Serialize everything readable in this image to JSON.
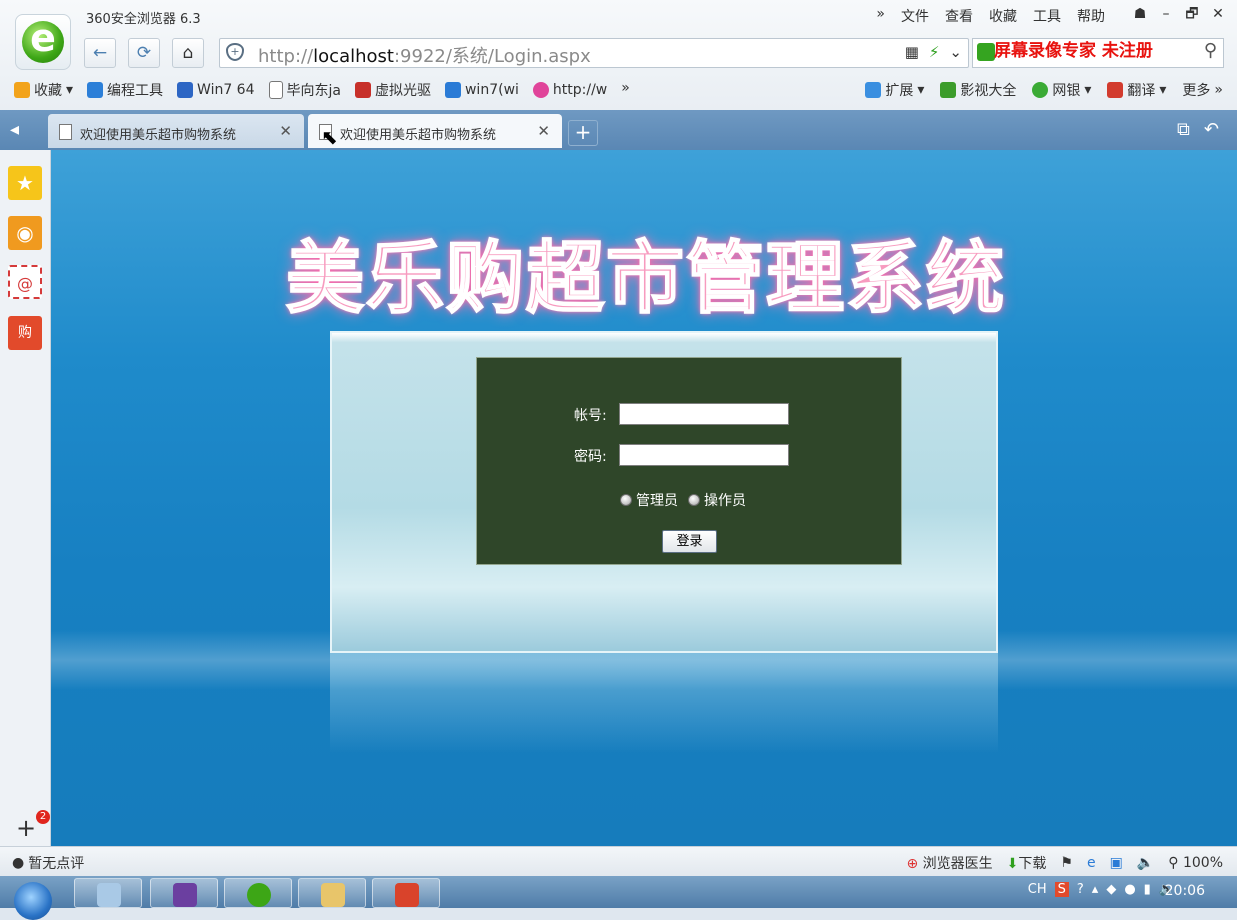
{
  "window": {
    "title": "360安全浏览器 6.3",
    "menu": [
      "文件",
      "查看",
      "收藏",
      "工具",
      "帮助"
    ],
    "controls": [
      "☗",
      "–",
      "🗗",
      "✕"
    ]
  },
  "nav": {
    "back_icon": "←",
    "refresh_icon": "⟳",
    "home_icon": "⌂",
    "url_prefix": "http://",
    "url_host": "localhost",
    "url_rest": ":9922/系统/Login.aspx",
    "qr_icon": "▦",
    "bolt_icon": "⚡",
    "dropdown_icon": "⌄",
    "search_placeholder": "",
    "search_icon": "⚲",
    "watermark": "屏幕录像专家 未注册"
  },
  "bookmarks": {
    "left": [
      {
        "label": "收藏",
        "color": "#f2a31b"
      },
      {
        "label": "编程工具",
        "color": "#2c7fd8"
      },
      {
        "label": "Win7 64",
        "color": "#2d66c4"
      },
      {
        "label": "毕向东ja",
        "color": "#ffffff"
      },
      {
        "label": "虚拟光驱",
        "color": "#c7302a"
      },
      {
        "label": "win7(wi",
        "color": "#2a7bd6"
      },
      {
        "label": "http://w",
        "color": "#e0449a"
      }
    ],
    "overflow": "»",
    "right": [
      {
        "label": "扩展",
        "color": "#3a8fe0"
      },
      {
        "label": "影视大全",
        "color": "#3c9c2b"
      },
      {
        "label": "网银",
        "color": "#3aaa35"
      },
      {
        "label": "翻译",
        "color": "#d23b2e"
      },
      {
        "label": "更多",
        "color": "#ffffff"
      }
    ]
  },
  "tabs": {
    "back_icon": "◂",
    "items": [
      {
        "label": "欢迎使用美乐超市购物系统",
        "close": "✕"
      },
      {
        "label": "欢迎使用美乐超市购物系统",
        "close": "✕"
      }
    ],
    "new_tab": "+",
    "tools": [
      "⧉",
      "↶"
    ]
  },
  "sidebar": {
    "icons": [
      "★",
      "◉",
      "@",
      "购"
    ],
    "add": "+",
    "badge": "2"
  },
  "page": {
    "heading": "美乐购超市管理系统",
    "account_label": "帐号:",
    "password_label": "密码:",
    "account_value": "",
    "password_value": "",
    "roles": [
      "管理员",
      "操作员"
    ],
    "login_button": "登录"
  },
  "status": {
    "left": "暂无点评",
    "right": [
      "浏览器医生",
      "下载",
      "100%"
    ]
  },
  "taskbar": {
    "tray_lang": "CH",
    "clock": "20:06"
  }
}
